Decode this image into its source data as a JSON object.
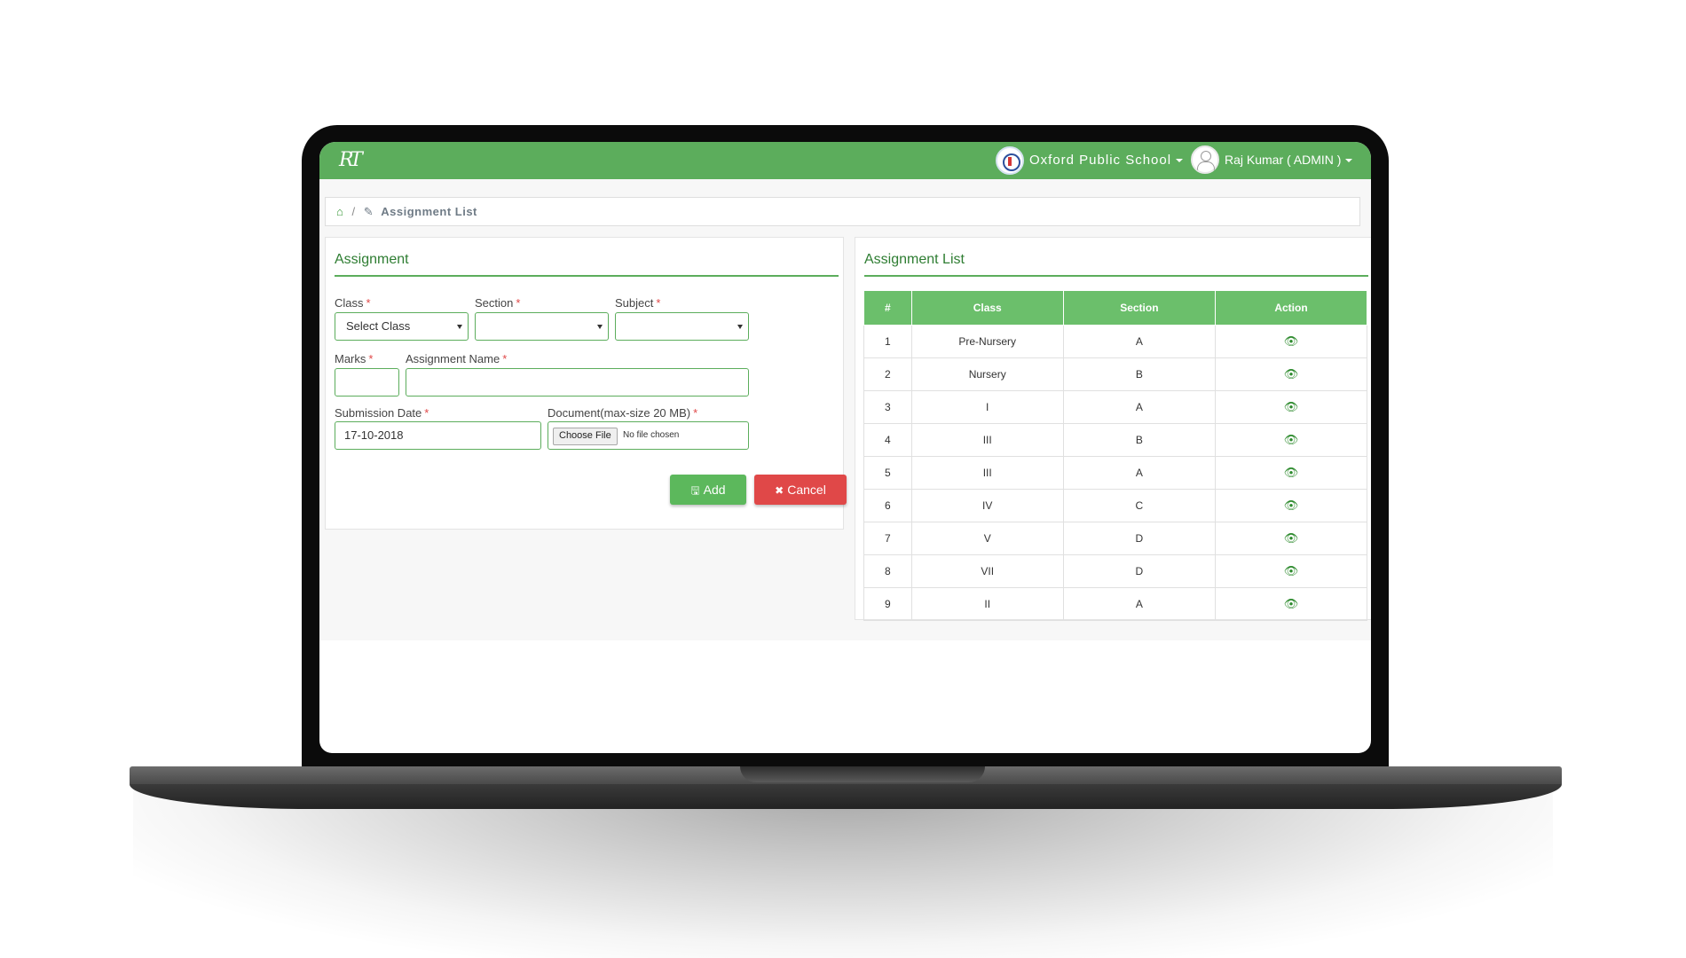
{
  "navbar": {
    "logo_text": "RT",
    "school_name": "Oxford Public School",
    "user_name": "Raj Kumar ( ADMIN )"
  },
  "breadcrumb": {
    "home_icon": "home-icon",
    "separator": "/",
    "current": "Assignment List"
  },
  "form": {
    "title": "Assignment",
    "class_label": "Class",
    "class_value": "Select Class",
    "section_label": "Section",
    "section_value": "",
    "subject_label": "Subject",
    "subject_value": "",
    "marks_label": "Marks",
    "marks_value": "",
    "assignment_name_label": "Assignment Name",
    "assignment_name_value": "",
    "submission_date_label": "Submission Date",
    "submission_date_value": "17-10-2018",
    "document_label": "Document(max-size 20 MB)",
    "choose_file_label": "Choose File",
    "no_file_text": "No file chosen",
    "required_mark": "*",
    "add_label": "Add",
    "cancel_label": "Cancel"
  },
  "list": {
    "title": "Assignment List",
    "columns": [
      "#",
      "Class",
      "Section",
      "Action"
    ],
    "rows": [
      {
        "num": "1",
        "class": "Pre-Nursery",
        "section": "A"
      },
      {
        "num": "2",
        "class": "Nursery",
        "section": "B"
      },
      {
        "num": "3",
        "class": "I",
        "section": "A"
      },
      {
        "num": "4",
        "class": "III",
        "section": "B"
      },
      {
        "num": "5",
        "class": "III",
        "section": "A"
      },
      {
        "num": "6",
        "class": "IV",
        "section": "C"
      },
      {
        "num": "7",
        "class": "V",
        "section": "D"
      },
      {
        "num": "8",
        "class": "VII",
        "section": "D"
      },
      {
        "num": "9",
        "class": "II",
        "section": "A"
      }
    ]
  },
  "colors": {
    "primary_green": "#5cad5c",
    "header_green": "#6bbf6b",
    "danger_red": "#e04848"
  }
}
